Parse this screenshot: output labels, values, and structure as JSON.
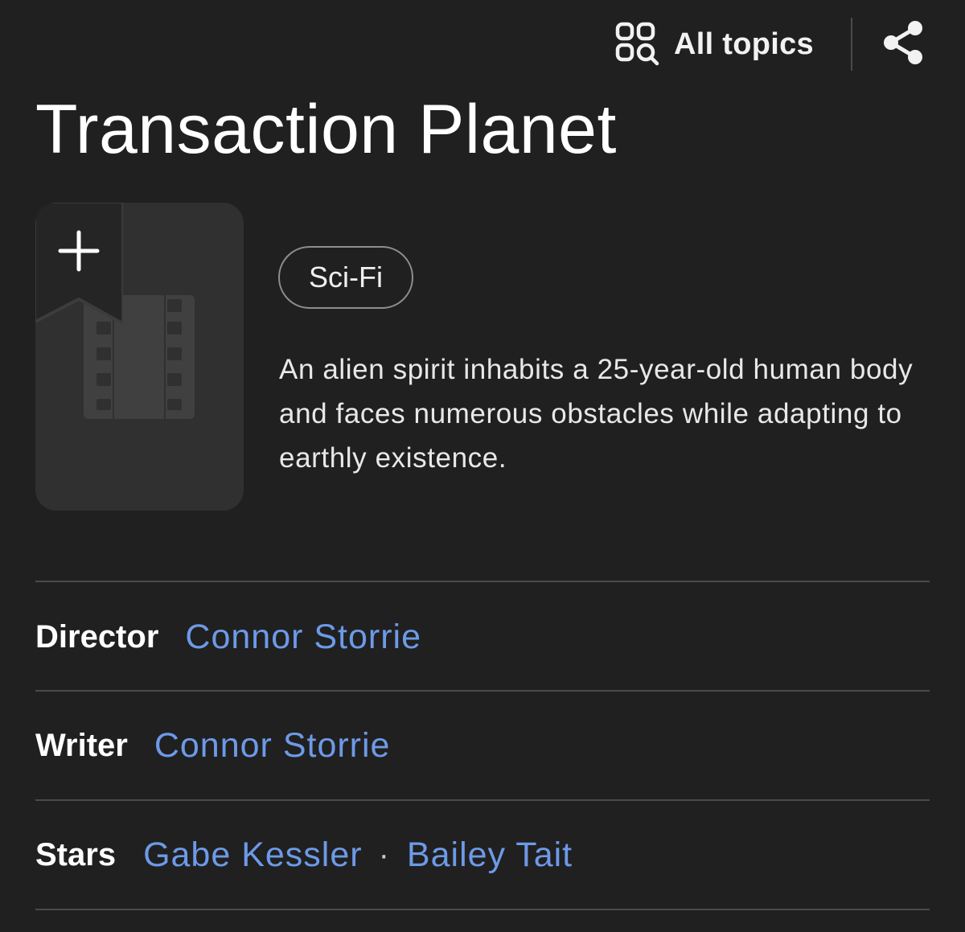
{
  "header": {
    "all_topics_label": "All topics",
    "share_icon": "share-icon",
    "all_topics_icon": "grid-search-icon"
  },
  "title": "Transaction Planet",
  "poster": {
    "placeholder_icon": "film-strip-icon",
    "add_icon": "plus-icon"
  },
  "genre": "Sci-Fi",
  "description": "An alien spirit inhabits a 25-year-old human body and faces numerous obstacles while adapting to earthly existence.",
  "credits": {
    "director": {
      "label": "Director",
      "names": [
        "Connor Storrie"
      ]
    },
    "writer": {
      "label": "Writer",
      "names": [
        "Connor Storrie"
      ]
    },
    "stars": {
      "label": "Stars",
      "names": [
        "Gabe Kessler",
        "Bailey Tait"
      ],
      "separator": "·"
    }
  },
  "colors": {
    "background": "#202020",
    "link": "#6d9ae8",
    "divider": "#4a4a4a",
    "poster": "#303030"
  }
}
